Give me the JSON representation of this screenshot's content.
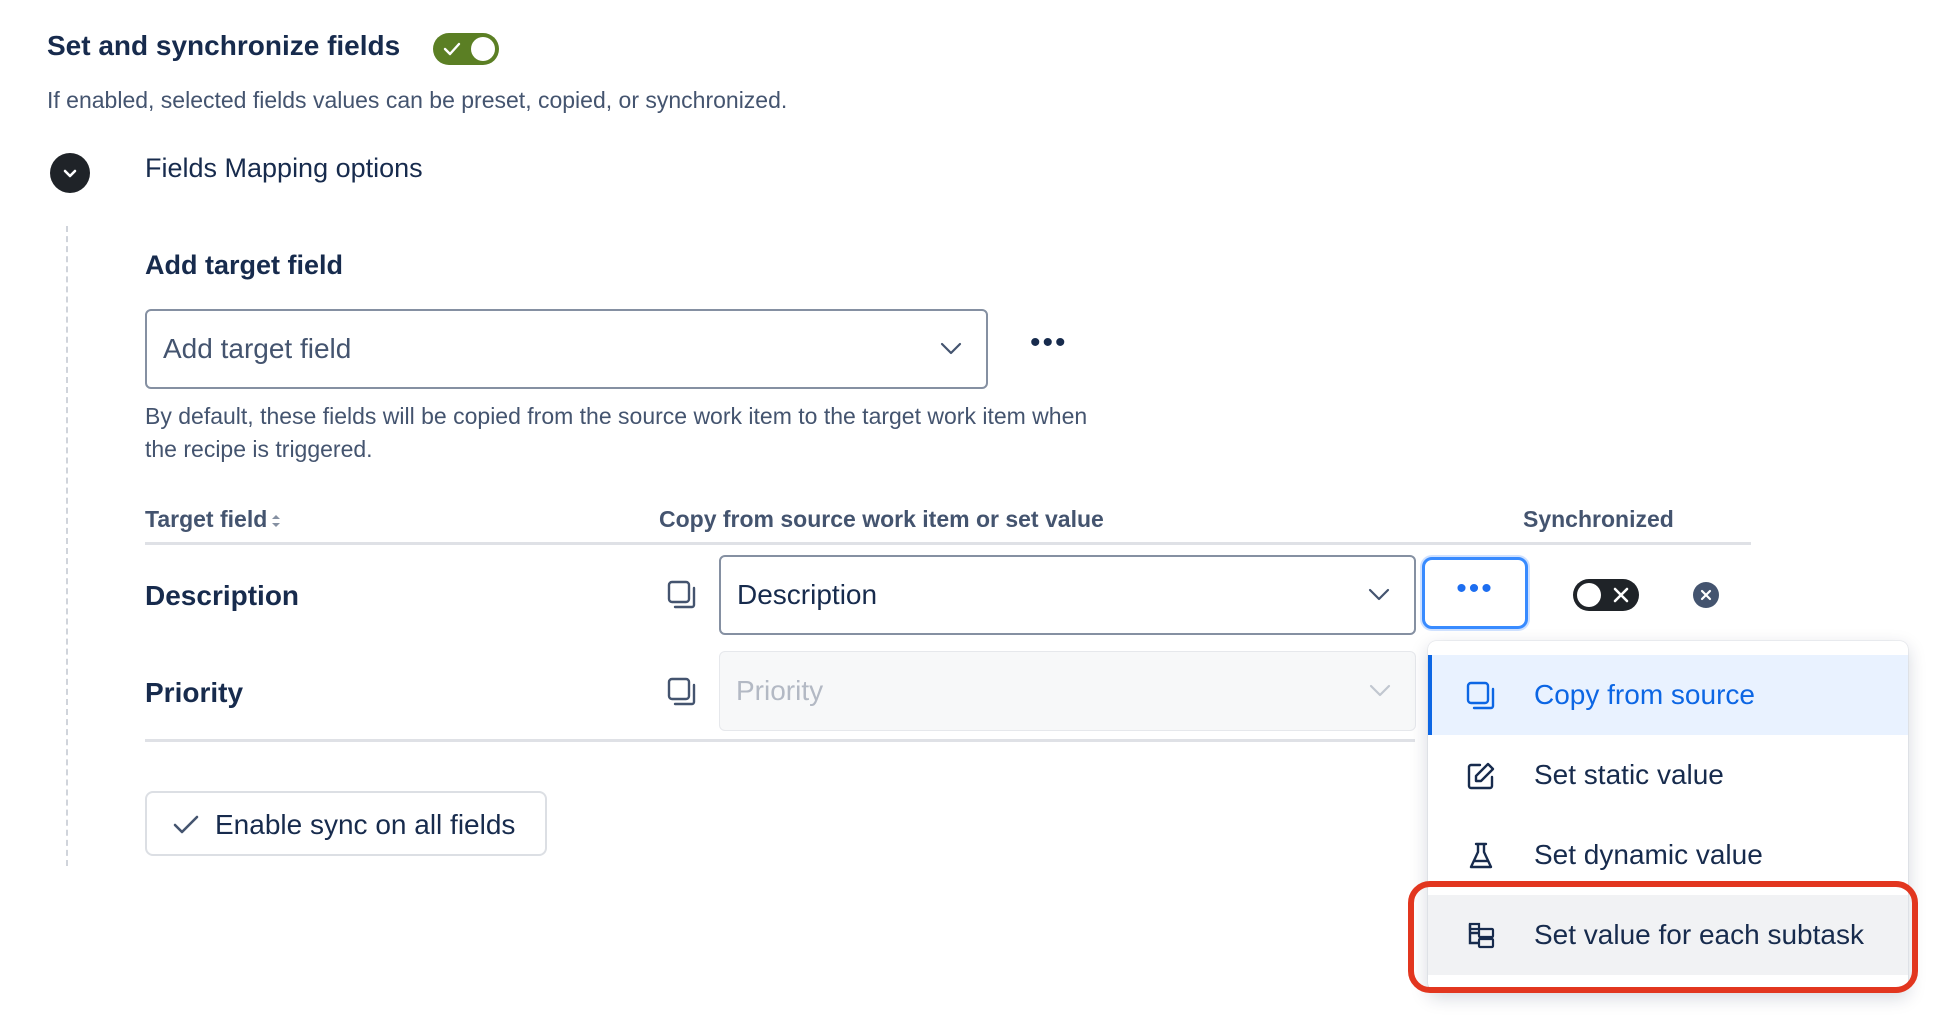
{
  "header": {
    "title": "Set and synchronize fields",
    "toggle_state": "on",
    "subtitle": "If enabled, selected fields values can be preset, copied, or synchronized."
  },
  "mapping": {
    "section_title": "Fields Mapping options",
    "add_target_label": "Add target field",
    "add_target_placeholder": "Add target field",
    "help_text": "By default, these fields will be copied from the source work item to the target work item when the recipe is triggered."
  },
  "table": {
    "columns": [
      "Target field",
      "Copy from source work item or set value",
      "Synchronized"
    ],
    "rows": [
      {
        "target": "Description",
        "value": "Description",
        "synchronized": "off"
      },
      {
        "target": "Priority",
        "value": "Priority",
        "disabled": true
      }
    ]
  },
  "sync_all_button": "Enable sync on all fields",
  "menu": {
    "items": [
      {
        "label": "Copy from source",
        "icon": "copy-icon",
        "state": "selected"
      },
      {
        "label": "Set static value",
        "icon": "edit-icon"
      },
      {
        "label": "Set dynamic value",
        "icon": "flask-icon"
      },
      {
        "label": "Set value for each subtask",
        "icon": "subtask-icon",
        "state": "hovered"
      }
    ]
  },
  "colors": {
    "toggle_on": "#5b7f24",
    "accent": "#0c66e4",
    "highlight": "#e2361f"
  }
}
